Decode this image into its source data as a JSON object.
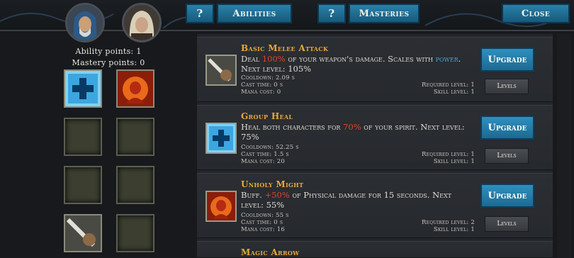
{
  "header": {
    "help_label_1": "?",
    "abilities_label": "Abilities",
    "help_label_2": "?",
    "masteries_label": "Masteries",
    "close_label": "Close"
  },
  "left": {
    "ability_points": "Ability points: 1",
    "mastery_points": "Mastery points: 0",
    "slots": [
      {
        "icon": "heal-cross-icon"
      },
      {
        "icon": "fire-demon-icon"
      },
      {
        "icon": "empty"
      },
      {
        "icon": "empty"
      },
      {
        "icon": "empty"
      },
      {
        "icon": "empty"
      },
      {
        "icon": "sword-fist-icon"
      },
      {
        "icon": "empty"
      }
    ]
  },
  "abilities": [
    {
      "title": "Basic Melee Attack",
      "desc_pre": "Deal ",
      "desc_hl": "100%",
      "desc_mid": " of your weapon's damage. Scales with ",
      "desc_hl2": "power",
      "desc_post": ". Next level: 105%",
      "cooldown": "Cooldown: 2.09 s",
      "cast_time": "Cast time: 0 s",
      "mana_cost": "Mana cost: 0",
      "required_level": "Required level: 1",
      "skill_level": "Skill level: 1",
      "upgrade_label": "Upgrade",
      "levels_label": "Levels",
      "icon": "sword-fist-icon"
    },
    {
      "title": "Group Heal",
      "desc_pre": "Heal both characters for ",
      "desc_hl": "70%",
      "desc_post": " of your spirit. Next level: 75%",
      "cooldown": "Cooldown: 52.25 s",
      "cast_time": "Cast time: 1.5 s",
      "mana_cost": "Mana cost: 20",
      "required_level": "Required level: 1",
      "skill_level": "Skill level: 1",
      "upgrade_label": "Upgrade",
      "levels_label": "Levels",
      "icon": "heal-cross-icon"
    },
    {
      "title": "Unholy Might",
      "desc_pre": "Buff. ",
      "desc_hl": "+50%",
      "desc_post": " of Physical damage for 15 seconds. Next level: 55%",
      "cooldown": "Cooldown: 55 s",
      "cast_time": "Cast time: 0 s",
      "mana_cost": "Mana cost: 16",
      "required_level": "Required level: 2",
      "skill_level": "Skill level: 1",
      "upgrade_label": "Upgrade",
      "levels_label": "Levels",
      "icon": "fire-demon-icon"
    },
    {
      "title": "Magic Arrow"
    }
  ],
  "colors": {
    "accent_blue": "#1c6a92",
    "title_gold": "#e8a93a",
    "highlight_red": "#e0452b",
    "highlight_blue": "#4aa3e0"
  }
}
